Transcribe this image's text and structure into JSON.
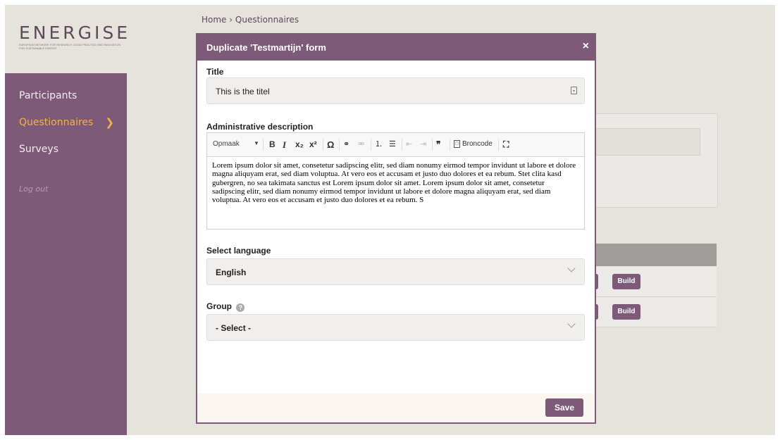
{
  "brand": {
    "name": "ENERGISE",
    "tagline": "EUROPEAN NETWORK FOR RESEARCH, GOOD PRACTICE AND INNOVATION FOR SUSTAINABLE ENERGY"
  },
  "sidebar": {
    "items": [
      {
        "label": "Participants",
        "active": false
      },
      {
        "label": "Questionnaires",
        "active": true
      },
      {
        "label": "Surveys",
        "active": false
      }
    ],
    "logout": "Log out"
  },
  "breadcrumb": {
    "home": "Home",
    "separator": "›",
    "current": "Questionnaires"
  },
  "background": {
    "build_label": "Build"
  },
  "modal": {
    "title": "Duplicate 'Testmartijn' form",
    "close": "×",
    "title_label": "Title",
    "title_value": "This is the titel",
    "description_label": "Administrative description",
    "toolbar": {
      "format": "Opmaak",
      "bold": "B",
      "italic": "I",
      "subscript": "x₂",
      "superscript": "x²",
      "special_char": "Ω",
      "link": "⚭",
      "unlink": "⚮",
      "numbered_list": "⒈",
      "bulleted_list": "☰",
      "outdent": "⇤",
      "indent": "⇥",
      "blockquote": "❞",
      "source": "Broncode",
      "maximize": "⛶"
    },
    "description_text": "Lorem ipsum dolor sit amet, consetetur sadipscing elitr, sed diam nonumy eirmod tempor invidunt ut labore et dolore magna aliquyam erat, sed diam voluptua. At vero eos et accusam et justo duo dolores et ea rebum. Stet clita kasd gubergren, no sea takimata sanctus est Lorem ipsum dolor sit amet. Lorem ipsum dolor sit amet, consetetur sadipscing elitr, sed diam nonumy eirmod tempor invidunt ut labore et dolore magna aliquyam erat, sed diam voluptua. At vero eos et accusam et justo duo dolores et ea rebum. S",
    "language_label": "Select language",
    "language_value": "English",
    "group_label": "Group",
    "group_help": "?",
    "group_value": "- Select -",
    "save": "Save"
  },
  "colors": {
    "brand_purple": "#7c5a78",
    "accent_yellow": "#f3b43c",
    "page_bg": "#e6e3dd"
  }
}
